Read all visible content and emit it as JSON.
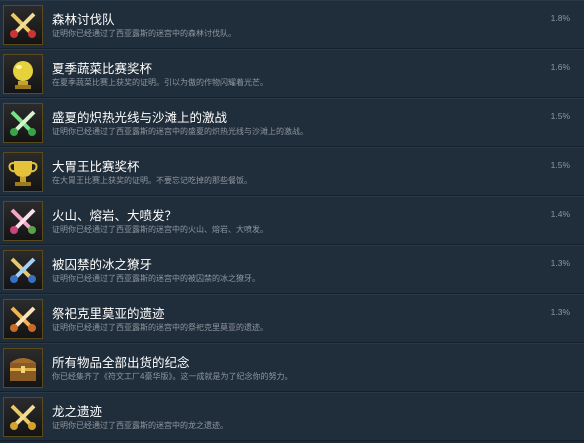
{
  "achievements": [
    {
      "title": "森林讨伐队",
      "desc": "证明你已经通过了西亚露斯的迷宫中的森林讨伐队。",
      "percent": "1.8%",
      "icon": "crossed-swords-icon"
    },
    {
      "title": "夏季蔬菜比赛奖杯",
      "desc": "在夏季蔬菜比赛上获奖的证明。引以为傲的作物闪耀着光芒。",
      "percent": "1.6%",
      "icon": "golden-apple-trophy-icon"
    },
    {
      "title": "盛夏的炽热光线与沙滩上的激战",
      "desc": "证明你已经通过了西亚露斯的迷宫中的盛夏的炽热光线与沙滩上的激战。",
      "percent": "1.5%",
      "icon": "green-swords-icon"
    },
    {
      "title": "大胃王比赛奖杯",
      "desc": "在大胃王比赛上获奖的证明。不要忘记吃掉的那些餐饭。",
      "percent": "1.5%",
      "icon": "golden-cup-trophy-icon"
    },
    {
      "title": "火山、熔岩、大喷发？",
      "desc": "证明你已经通过了西亚露斯的迷宫中的火山、熔岩、大喷发。",
      "percent": "1.4%",
      "icon": "pink-swords-icon"
    },
    {
      "title": "被囚禁的冰之獠牙",
      "desc": "证明你已经通过了西亚露斯的迷宫中的被囚禁的冰之獠牙。",
      "percent": "1.3%",
      "icon": "blue-swords-icon"
    },
    {
      "title": "祭祀克里莫亚的遗迹",
      "desc": "证明你已经通过了西亚露斯的迷宫中的祭祀克里莫亚的遗迹。",
      "percent": "1.3%",
      "icon": "orange-swords-icon"
    },
    {
      "title": "所有物品全部出货的纪念",
      "desc": "你已经集齐了《符文工厂4豪华版》。这一成就是为了纪念你的努力。",
      "percent": "",
      "icon": "treasure-chest-icon"
    },
    {
      "title": "龙之遗迹",
      "desc": "证明你已经通过了西亚露斯的迷宫中的龙之遗迹。",
      "percent": "",
      "icon": "golden-swords-icon"
    }
  ]
}
